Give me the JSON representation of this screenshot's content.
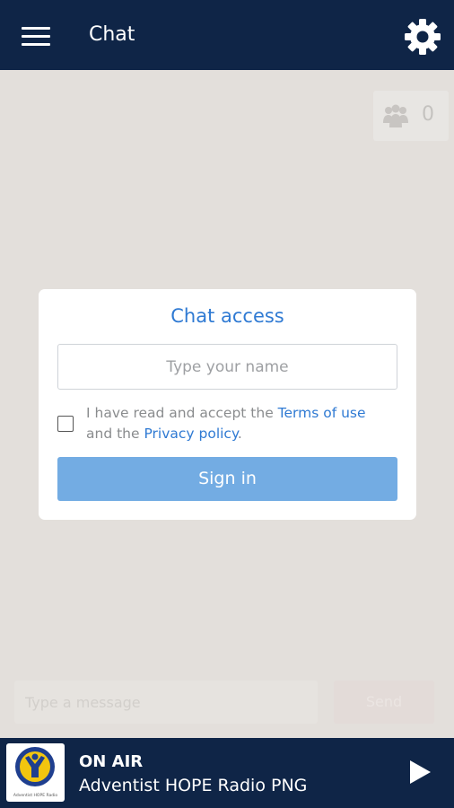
{
  "header": {
    "title": "Chat",
    "menu_icon": "hamburger-menu-icon",
    "settings_icon": "gear-icon"
  },
  "online_users": {
    "icon": "users-group-icon",
    "count": "0"
  },
  "chat_access": {
    "title": "Chat access",
    "name_placeholder": "Type your name",
    "consent_prefix": "I have read and accept the ",
    "terms_link": "Terms of use",
    "consent_middle": " and the ",
    "privacy_link": "Privacy policy",
    "consent_suffix": ".",
    "checkbox_checked": false,
    "sign_in_label": "Sign in"
  },
  "composer": {
    "placeholder": "Type a message",
    "send_label": "Send"
  },
  "player": {
    "status": "ON AIR",
    "station": "Adventist HOPE Radio PNG",
    "logo_text": "Adventist HOPE Radio",
    "play_icon": "play-icon"
  },
  "colors": {
    "bar": "#0f2547",
    "background": "#e3dfdb",
    "accent": "#2f7ad3",
    "button": "#73ace3"
  }
}
